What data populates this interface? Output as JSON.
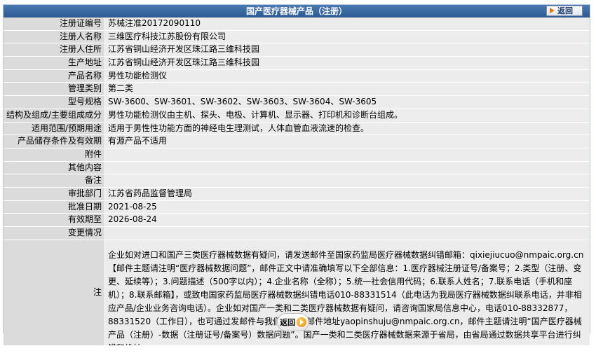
{
  "header": {
    "title": "国产医疗器械产品（注册）",
    "back_label": "返回"
  },
  "rows": [
    {
      "label": "注册证编号",
      "value": "苏械注准20172090110"
    },
    {
      "label": "注册人名称",
      "value": "三维医疗科技江苏股份有限公司"
    },
    {
      "label": "注册人住所",
      "value": "江苏省铜山经济开发区珠江路三维科技园"
    },
    {
      "label": "生产地址",
      "value": "江苏省铜山经济开发区珠江路三维科技园"
    },
    {
      "label": "产品名称",
      "value": "男性功能检测仪"
    },
    {
      "label": "管理类别",
      "value": "第二类"
    },
    {
      "label": "型号规格",
      "value": "SW-3600、SW-3601、SW-3602、SW-3603、SW-3604、SW-3605"
    },
    {
      "label": "结构及组成/主要组成成分",
      "value": "男性功能检测仪由主机、探头、电极、计算机、显示器、打印机和诊断台组成。"
    },
    {
      "label": "适用范围/预期用途",
      "value": "适用于男性性功能方面的神经电生理测试，人体血管血液流速的检查。"
    },
    {
      "label": "产品储存条件及有效期",
      "value": "有源产品不适用"
    },
    {
      "label": "附件",
      "value": ""
    },
    {
      "label": "其他内容",
      "value": ""
    },
    {
      "label": "备注",
      "value": ""
    },
    {
      "label": "审批部门",
      "value": "江苏省药品监督管理局"
    },
    {
      "label": "批准日期",
      "value": "2021-08-25"
    },
    {
      "label": "有效期至",
      "value": "2026-08-24"
    },
    {
      "label": "变更情况",
      "value": ""
    }
  ],
  "note": {
    "label": "注",
    "text": "企业如对进口和国产三类医疗器械数据有疑问，请发送邮件至国家药监局医疗器械数据纠错邮箱：qixiejiucuo@nmpaic.org.cn【邮件主题请注明“医疗器械数据问题”，邮件正文中请准确填写以下全部信息：1.医疗器械注册证号/备案号；2.类型（注册、变更、延续等）；3.问题描述（500字以内）；4.企业名称（全称）；5.统一社会信用代码；6.联系人姓名；7.联系电话（手机和座机）；8.联系邮箱】，或致电国家药监局医疗器械数据纠错电话010-88331514（此电话为我局医疗器械数据纠联系电话，并非相应产品/企业业务咨询电话）。企业如对国产一类和二类医疗器械数据有疑问，请咨询国家局信息中心，电话010-88332877，88331520（工作日），也可通过发邮件与我们联系：邮件地址yaopinshuju@nmpaic.org.cn，邮件主题请注明“国产医疗器械产品（注册）-数据（注册证号/备案号）数据问题”。国产一类和二类医疗器械数据来源于省局，由省局通过数据共享平台进行纠错和维护。"
  },
  "footer": {
    "back_label": "返回"
  }
}
